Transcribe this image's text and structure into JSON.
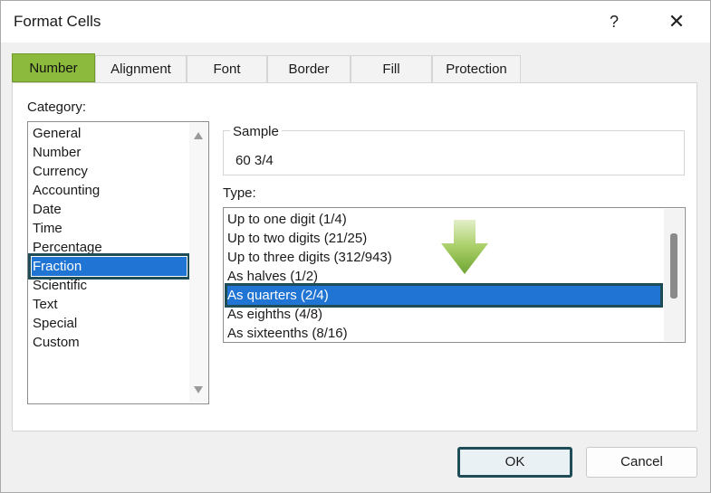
{
  "window": {
    "title": "Format Cells",
    "help_label": "?",
    "close_label": "✕"
  },
  "tabs": [
    {
      "label": "Number",
      "active": true
    },
    {
      "label": "Alignment",
      "active": false
    },
    {
      "label": "Font",
      "active": false
    },
    {
      "label": "Border",
      "active": false
    },
    {
      "label": "Fill",
      "active": false
    },
    {
      "label": "Protection",
      "active": false
    }
  ],
  "category": {
    "label": "Category:",
    "items": [
      "General",
      "Number",
      "Currency",
      "Accounting",
      "Date",
      "Time",
      "Percentage",
      "Fraction",
      "Scientific",
      "Text",
      "Special",
      "Custom"
    ],
    "selected": "Fraction"
  },
  "sample": {
    "legend": "Sample",
    "value": "60 3/4"
  },
  "type": {
    "label": "Type:",
    "items": [
      "Up to one digit (1/4)",
      "Up to two digits (21/25)",
      "Up to three digits (312/943)",
      "As halves (1/2)",
      "As quarters (2/4)",
      "As eighths (4/8)",
      "As sixteenths (8/16)"
    ],
    "selected": "As quarters (2/4)"
  },
  "buttons": {
    "ok": "OK",
    "cancel": "Cancel"
  },
  "colors": {
    "active_tab": "#8cba3d",
    "selection": "#1f74d4",
    "highlight_border": "#1e4d57",
    "indicator_arrow": "#8cbf3f"
  },
  "icons": {
    "indicator": "green-down-arrow-icon"
  }
}
